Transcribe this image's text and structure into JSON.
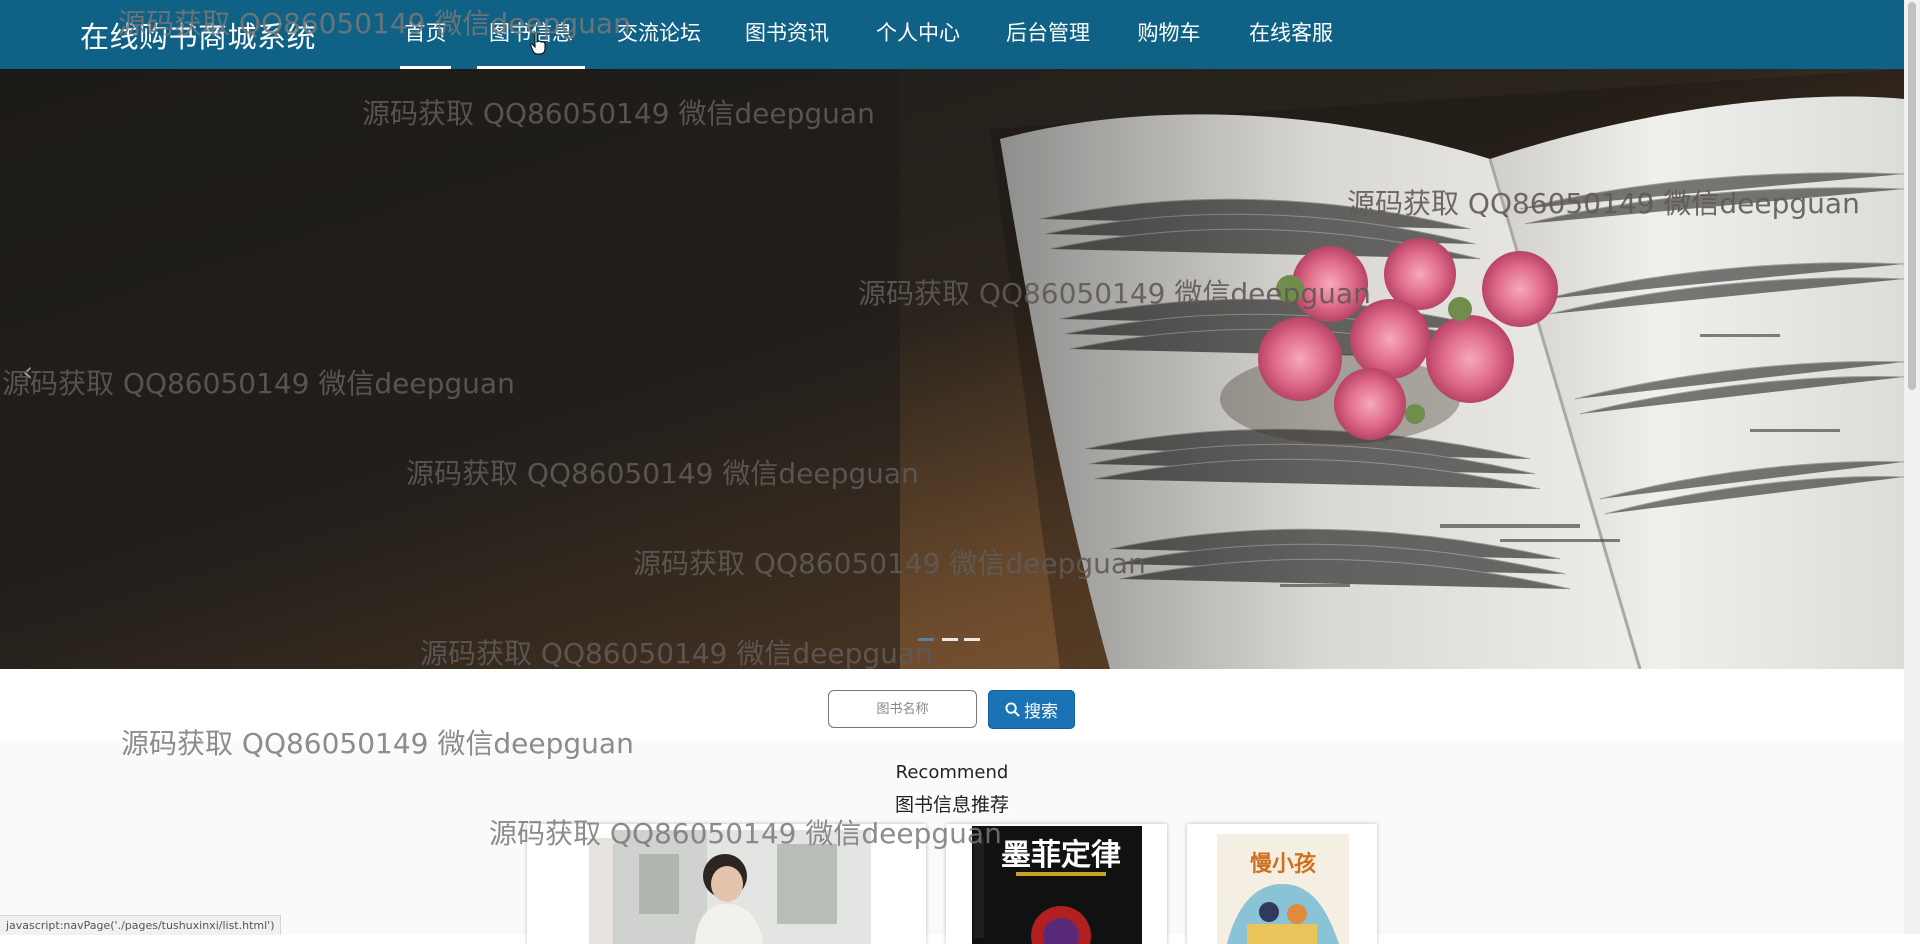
{
  "header": {
    "brand": "在线购书商城系统",
    "nav": [
      {
        "label": "首页"
      },
      {
        "label": "图书信息"
      },
      {
        "label": "交流论坛"
      },
      {
        "label": "图书资讯"
      },
      {
        "label": "个人中心"
      },
      {
        "label": "后台管理"
      },
      {
        "label": "购物车"
      },
      {
        "label": "在线客服"
      }
    ],
    "active_color": "#0f6285"
  },
  "carousel": {
    "prev_glyph": "‹",
    "slide_count": 3,
    "active_index": 0
  },
  "search": {
    "placeholder": "图书名称",
    "button_label": "搜索",
    "button_color": "#1a73b5"
  },
  "recommend": {
    "title_en": "Recommend",
    "title_cn": "图书信息推荐",
    "books": [
      {
        "cover_text": ""
      },
      {
        "cover_text": "墨菲定律"
      },
      {
        "cover_text": "慢小孩"
      }
    ]
  },
  "watermark": {
    "text": "源码获取 QQ86050149 微信deepguan"
  },
  "status_bar": {
    "url": "javascript:navPage('./pages/tushuxinxi/list.html')"
  }
}
